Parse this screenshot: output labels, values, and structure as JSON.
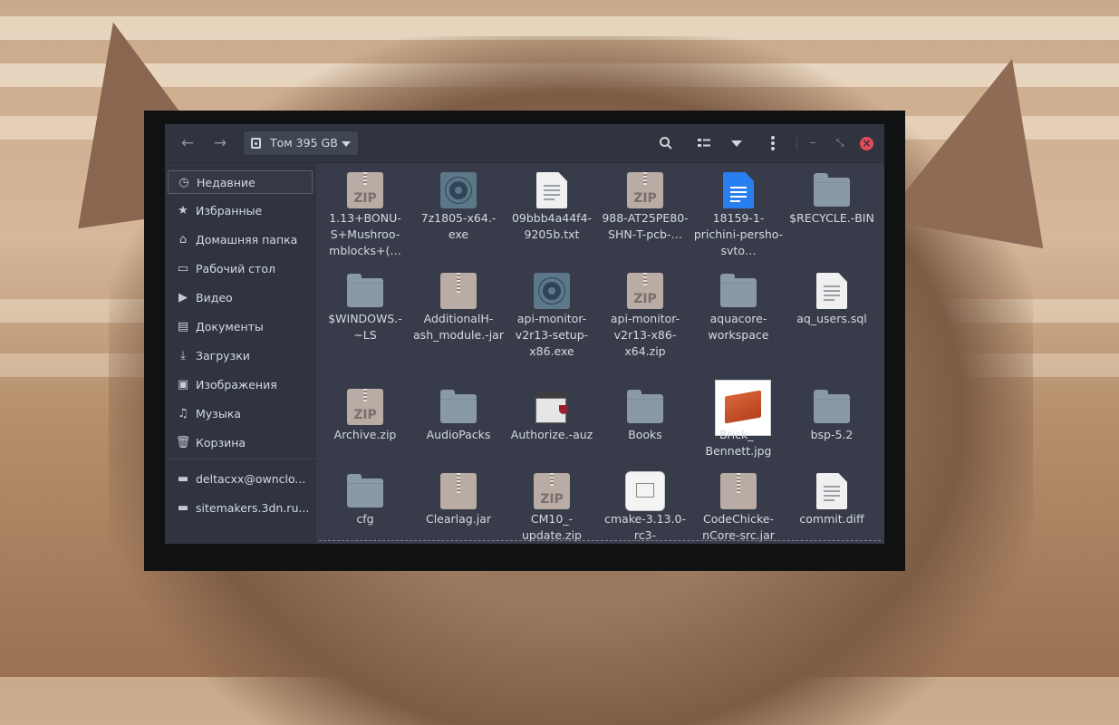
{
  "window": {
    "location": "Том 395 GB",
    "colors": {
      "header": "#2f343f",
      "content": "#383c4a",
      "close": "#e64a5a",
      "text": "#d3dae3"
    }
  },
  "header": {
    "back_icon": "←",
    "forward_icon": "→",
    "search_icon": "⌕",
    "minimize_icon": "–",
    "restore_icon": "⤡",
    "close_icon": "×"
  },
  "sidebar": {
    "items": [
      {
        "label": "Недавние",
        "icon": "clock-icon",
        "glyph": "◷"
      },
      {
        "label": "Избранные",
        "icon": "star-icon",
        "glyph": "★"
      },
      {
        "label": "Домашняя папка",
        "icon": "home-icon",
        "glyph": "⌂"
      },
      {
        "label": "Рабочий стол",
        "icon": "desktop-icon",
        "glyph": "▭"
      },
      {
        "label": "Видео",
        "icon": "video-icon",
        "glyph": "▶"
      },
      {
        "label": "Документы",
        "icon": "document-icon",
        "glyph": "▤"
      },
      {
        "label": "Загрузки",
        "icon": "download-icon",
        "glyph": "⤓"
      },
      {
        "label": "Изображения",
        "icon": "image-icon",
        "glyph": "▣"
      },
      {
        "label": "Музыка",
        "icon": "music-icon",
        "glyph": "♫"
      },
      {
        "label": "Корзина",
        "icon": "trash-icon",
        "glyph": "🗑"
      },
      {
        "label": "deltacxx@ownclo...",
        "icon": "network-icon",
        "glyph": "▬"
      },
      {
        "label": "sitemakers.3dn.ru...",
        "icon": "network-icon",
        "glyph": "▬"
      }
    ]
  },
  "files": [
    {
      "name": "1.13+BONUS+Mushroomblocks+(…",
      "type": "zip"
    },
    {
      "name": "7z1805-x64.exe",
      "type": "exe"
    },
    {
      "name": "09bbb4a44f49205b.txt",
      "type": "txt"
    },
    {
      "name": "988-AT25PE80-SHN-T-pcb-…",
      "type": "zip"
    },
    {
      "name": "18159-1-prichini-persho-svto…",
      "type": "doc"
    },
    {
      "name": "$RECYCLE.BIN",
      "type": "folder"
    },
    {
      "name": "$WINDOWS.~LS",
      "type": "folder"
    },
    {
      "name": "AdditionalHash_module.jar",
      "type": "jar"
    },
    {
      "name": "api-monitor-v2r13-setup-x86.exe",
      "type": "exe"
    },
    {
      "name": "api-monitor-v2r13-x86-x64.zip",
      "type": "zip"
    },
    {
      "name": "aquacore-workspace",
      "type": "folder"
    },
    {
      "name": "aq_users.sql",
      "type": "txt"
    },
    {
      "name": "Archive.zip",
      "type": "zip"
    },
    {
      "name": "AudioPacks",
      "type": "folder"
    },
    {
      "name": "Authorize.auz",
      "type": "wine"
    },
    {
      "name": "Books",
      "type": "folder"
    },
    {
      "name": "Brick_-Bennett.jpg",
      "type": "brick"
    },
    {
      "name": "bsp-5.2",
      "type": "folder"
    },
    {
      "name": "cfg",
      "type": "folder"
    },
    {
      "name": "Clearlag.jar",
      "type": "jar"
    },
    {
      "name": "CM10_-update.zip",
      "type": "zip"
    },
    {
      "name": "cmake-3.13.0-rc3-",
      "type": "cmake"
    },
    {
      "name": "CodeChicken-Core-src.jar",
      "type": "jar"
    },
    {
      "name": "commit.diff",
      "type": "txt"
    }
  ],
  "file_labels": [
    "1.13+BONU-S+Mushroo-mblocks+(…",
    "7z1805-x64.-exe",
    "09bbb4a44f4-9205b.txt",
    "988-AT25PE80-SHN-T-pcb-…",
    "18159-1-prichini-persho-svto…",
    "$RECYCLE.-BIN",
    "$WINDOWS.-~LS",
    "AdditionalH-ash_module.-jar",
    "api-monitor-v2r13-setup-x86.exe",
    "api-monitor-v2r13-x86-x64.zip",
    "aquacore-workspace",
    "aq_users.sql",
    "Archive.zip",
    "AudioPacks",
    "Authorize.-auz",
    "Books",
    "Brick_-Bennett.jpg",
    "bsp-5.2",
    "cfg",
    "Clearlag.jar",
    "CM10_-update.zip",
    "cmake-3.13.0-rc3-",
    "CodeChicke-nCore-src.jar",
    "commit.diff"
  ],
  "zip_text": "ZIP"
}
